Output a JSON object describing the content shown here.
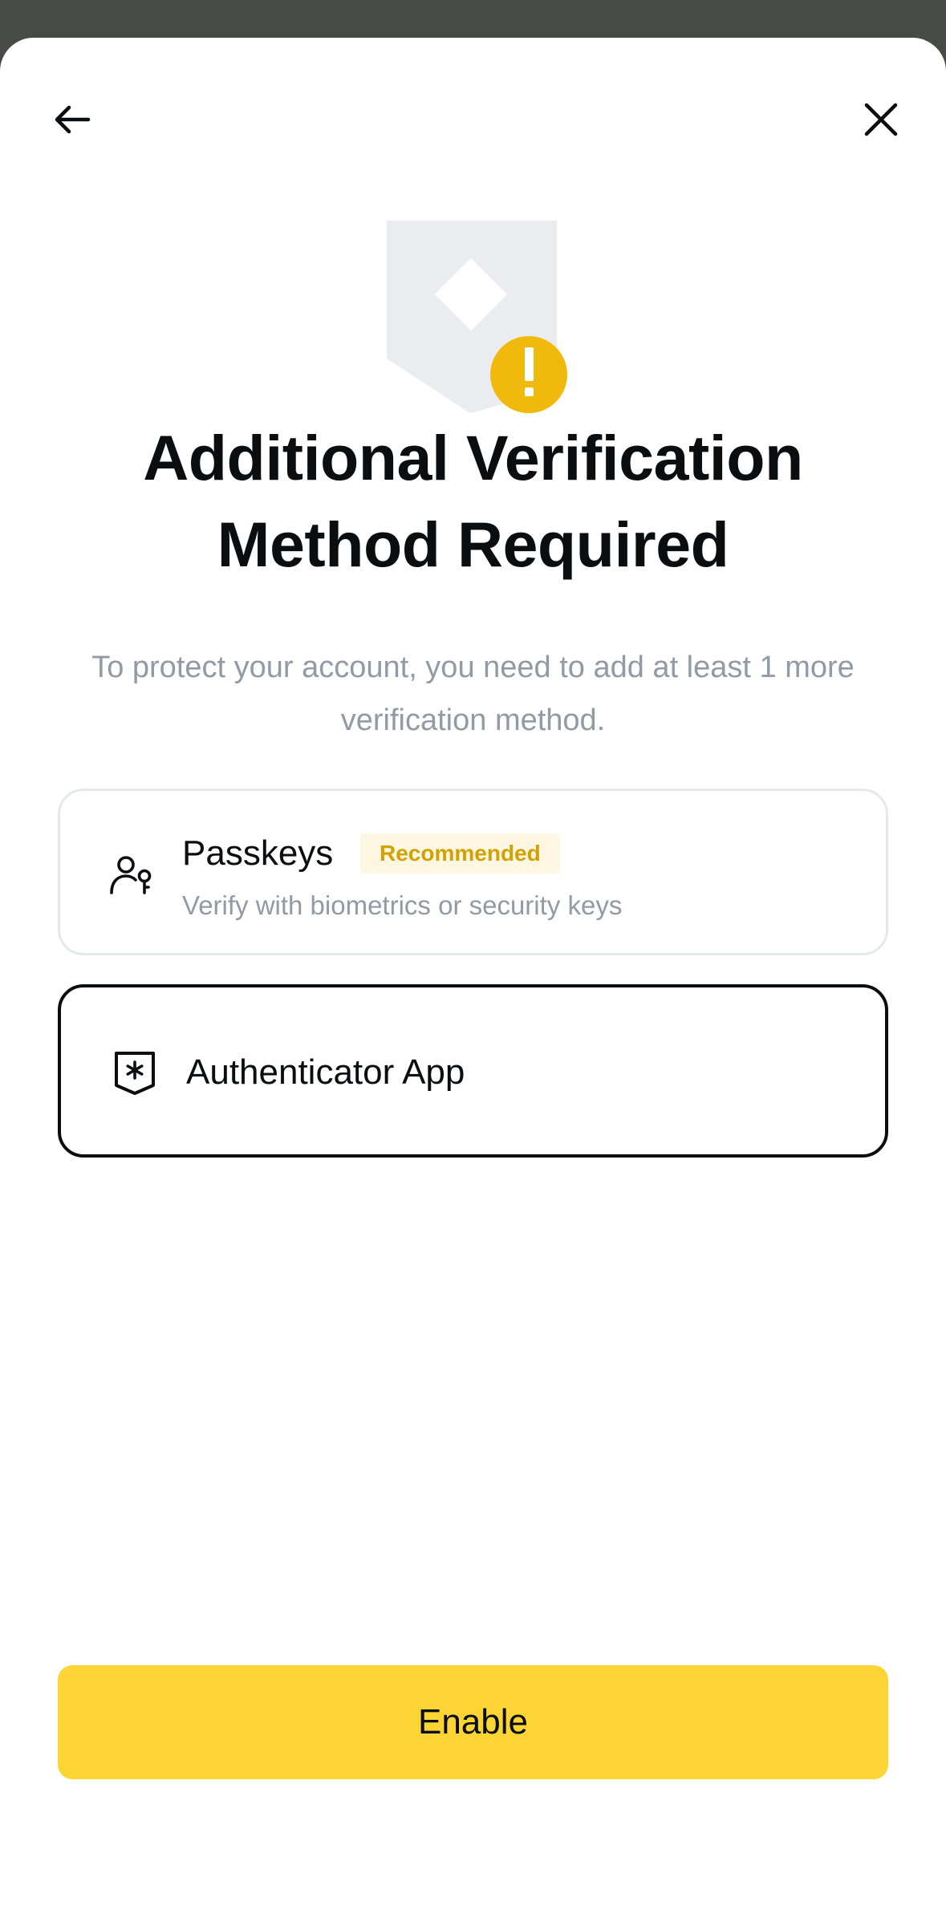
{
  "header": {
    "back_icon": "arrow-left-icon",
    "close_icon": "close-icon"
  },
  "hero": {
    "icon": "shield-warning-icon",
    "warning_glyph": "!",
    "colors": {
      "shield": "#eaecef",
      "warning": "#f0b90b"
    }
  },
  "title": "Additional Verification Method Required",
  "subtitle": "To protect your account, you need to add at least 1 more verification method.",
  "options": [
    {
      "icon": "passkey-user-icon",
      "label": "Passkeys",
      "badge": "Recommended",
      "description": "Verify with biometrics or security keys",
      "selected": false
    },
    {
      "icon": "authenticator-shield-icon",
      "label": "Authenticator App",
      "selected": true
    }
  ],
  "enable_button": {
    "label": "Enable",
    "color": "#fcd535"
  }
}
